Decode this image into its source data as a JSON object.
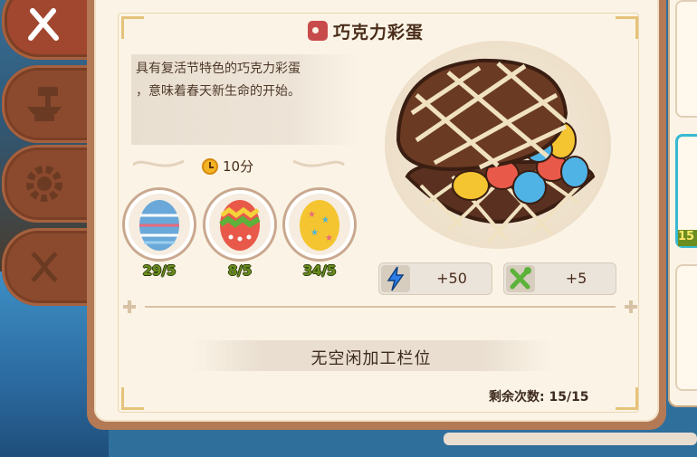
{
  "recipe": {
    "title": "巧克力彩蛋",
    "description_line1": "具有复活节特色的巧克力彩蛋",
    "description_line2": "，意味着春天新生命的开始。",
    "time": "10分"
  },
  "ingredients": [
    {
      "name": "blue-striped-egg",
      "count": "29/5"
    },
    {
      "name": "red-green-egg",
      "count": "8/5"
    },
    {
      "name": "yellow-star-egg",
      "count": "34/5"
    }
  ],
  "rewards": [
    {
      "icon": "lightning-icon",
      "value": "+50",
      "color": "#2d7ee6"
    },
    {
      "icon": "fork-spoon-icon",
      "value": "+5",
      "color": "#5cb23a"
    }
  ],
  "status": "无空闲加工栏位",
  "remaining": "剩余次数: 15/15",
  "right_panel": {
    "card_badge": "15"
  },
  "tabs": [
    {
      "icon": "fork-knife-icon"
    },
    {
      "icon": "anvil-icon"
    },
    {
      "icon": "gear-icon"
    },
    {
      "icon": "dna-icon"
    }
  ]
}
